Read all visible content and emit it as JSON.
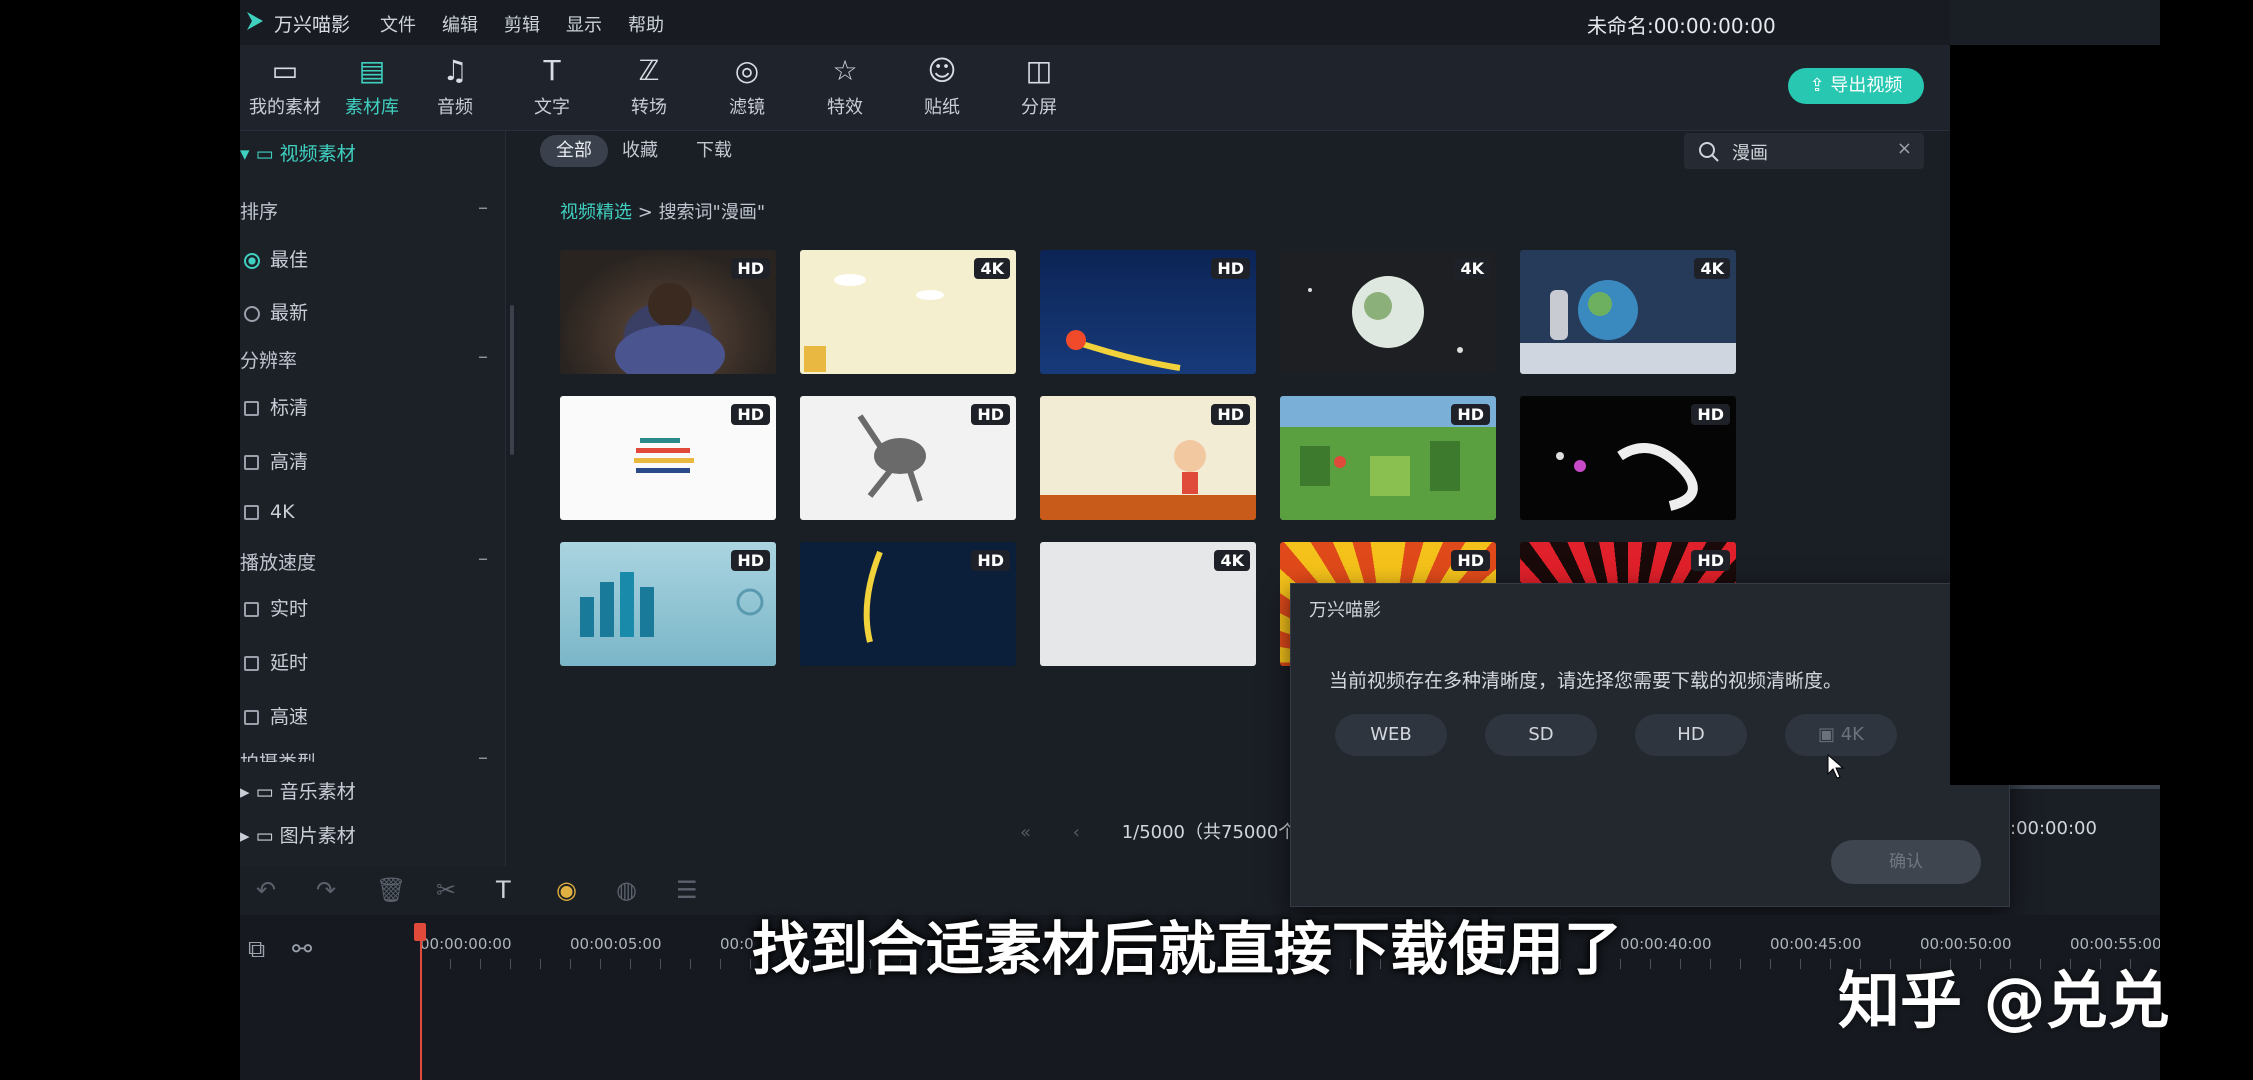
{
  "app": {
    "name": "万兴喵影",
    "menu": [
      "文件",
      "编辑",
      "剪辑",
      "显示",
      "帮助"
    ],
    "project_title": "未命名:00:00:00:00"
  },
  "toolbar": {
    "tools": [
      {
        "label": "我的素材",
        "icon": "folder-box-icon",
        "glyph": "▭"
      },
      {
        "label": "素材库",
        "icon": "library-folder-icon",
        "glyph": "▤"
      },
      {
        "label": "音频",
        "icon": "music-note-icon",
        "glyph": "♫"
      },
      {
        "label": "文字",
        "icon": "text-icon",
        "glyph": "T"
      },
      {
        "label": "转场",
        "icon": "transition-icon",
        "glyph": "ℤ"
      },
      {
        "label": "滤镜",
        "icon": "filter-icon",
        "glyph": "◎"
      },
      {
        "label": "特效",
        "icon": "effects-star-icon",
        "glyph": "☆"
      },
      {
        "label": "贴纸",
        "icon": "sticker-smiley-icon",
        "glyph": "☺"
      },
      {
        "label": "分屏",
        "icon": "split-screen-icon",
        "glyph": "◫"
      }
    ],
    "active_index": 1,
    "export_label": "导出视频"
  },
  "left_panel": {
    "video_folder": "视频素材",
    "sort_header": "排序",
    "sort_options": [
      "最佳",
      "最新"
    ],
    "resolution_header": "分辨率",
    "resolution_options": [
      "标清",
      "高清",
      "4K"
    ],
    "speed_header": "播放速度",
    "speed_options": [
      "实时",
      "延时",
      "高速"
    ],
    "shoot_header": "拍摄类型",
    "music_folder": "音乐素材",
    "image_folder": "图片素材"
  },
  "filter_tabs": [
    "全部",
    "收藏",
    "下载"
  ],
  "search": {
    "query": "漫画"
  },
  "breadcrumb": {
    "root": "视频精选",
    "separator": ">",
    "current": "搜索词\"漫画\""
  },
  "thumbnails": [
    {
      "badge": "HD",
      "scene": "chimp"
    },
    {
      "badge": "4K",
      "scene": "clouds"
    },
    {
      "badge": "HD",
      "scene": "comet"
    },
    {
      "badge": "4K",
      "scene": "moon"
    },
    {
      "badge": "4K",
      "scene": "astronaut"
    },
    {
      "badge": "HD",
      "scene": "chart"
    },
    {
      "badge": "HD",
      "scene": "dancer"
    },
    {
      "badge": "HD",
      "scene": "cartoon-boy"
    },
    {
      "badge": "HD",
      "scene": "city-green"
    },
    {
      "badge": "HD",
      "scene": "ink"
    },
    {
      "badge": "HD",
      "scene": "city-blue"
    },
    {
      "badge": "HD",
      "scene": "lightning"
    },
    {
      "badge": "4K",
      "scene": "paper"
    },
    {
      "badge": "HD",
      "scene": "sunburst"
    },
    {
      "badge": "HD",
      "scene": "red-burst"
    }
  ],
  "dialog": {
    "title": "万兴喵影",
    "message": "当前视频存在多种清晰度，请选择您需要下载的视频清晰度。",
    "options": [
      "WEB",
      "SD",
      "HD",
      "4K"
    ],
    "confirm": "确认"
  },
  "pager": {
    "text": "1/5000（共75000个",
    "time": ":00:00:00"
  },
  "timeline": {
    "labels": [
      "00:00:00:00",
      "00:00:05:00",
      "00:0",
      "00:00:40:00",
      "00:00:45:00",
      "00:00:50:00",
      "00:00:55:00"
    ]
  },
  "overlay": {
    "subtitle": "找到合适素材后就直接下载使用了",
    "watermark": "知乎 @兑兑"
  },
  "colors": {
    "accent": "#3fd0c0",
    "export": "#28c7b1",
    "playhead": "#e04a3a",
    "bg": "#1a1e25"
  }
}
